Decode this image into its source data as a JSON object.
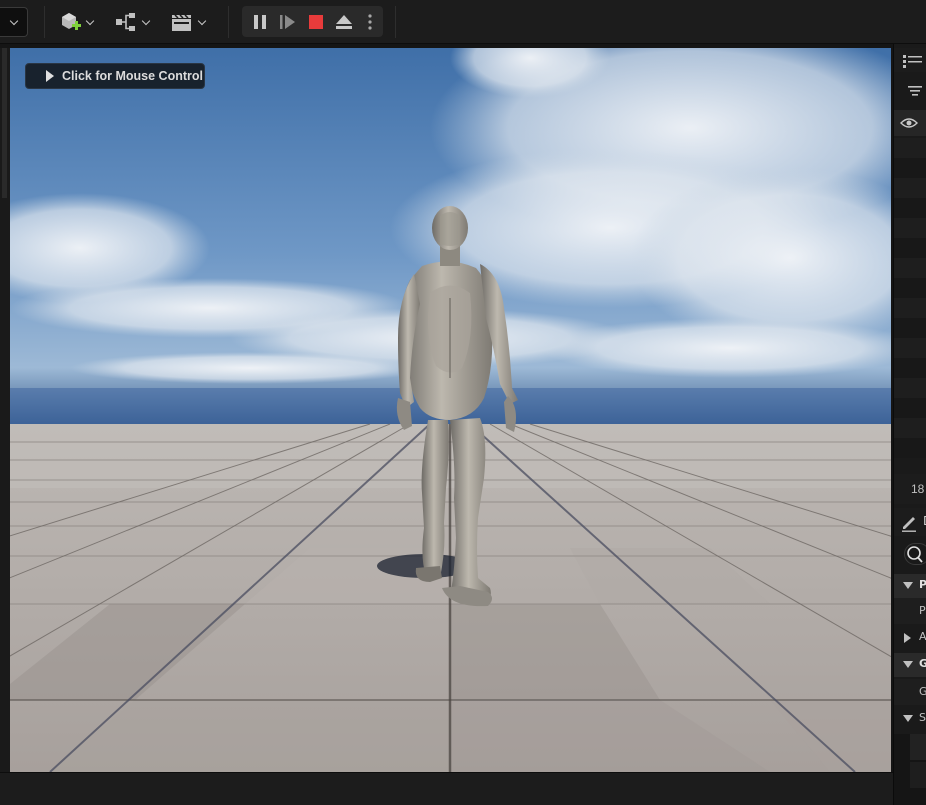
{
  "toolbar": {
    "left_dropdown": "chevron-down-icon",
    "add_actor": "add-actor-icon",
    "blueprints": "blueprint-icon",
    "cinematics": "clapper-icon",
    "play_controls": [
      "pause-icon",
      "advance-frame-icon",
      "stop-icon",
      "eject-icon",
      "more-options-icon"
    ]
  },
  "viewport": {
    "mouse_control_label": "Click for Mouse Control"
  },
  "outliner": {
    "item_count": "18"
  },
  "details": {
    "sections": [
      {
        "label": "P",
        "expanded": true,
        "child": "P"
      },
      {
        "label": "A",
        "expanded": false
      },
      {
        "label": "G",
        "expanded": true,
        "child": "G"
      },
      {
        "label": "S",
        "expanded": true
      }
    ]
  },
  "colors": {
    "stop": "#e83b3b",
    "accent_green": "#7fd13b",
    "toolbar_bg": "#1c1c1c",
    "panel_bg": "#1a1a1a"
  }
}
